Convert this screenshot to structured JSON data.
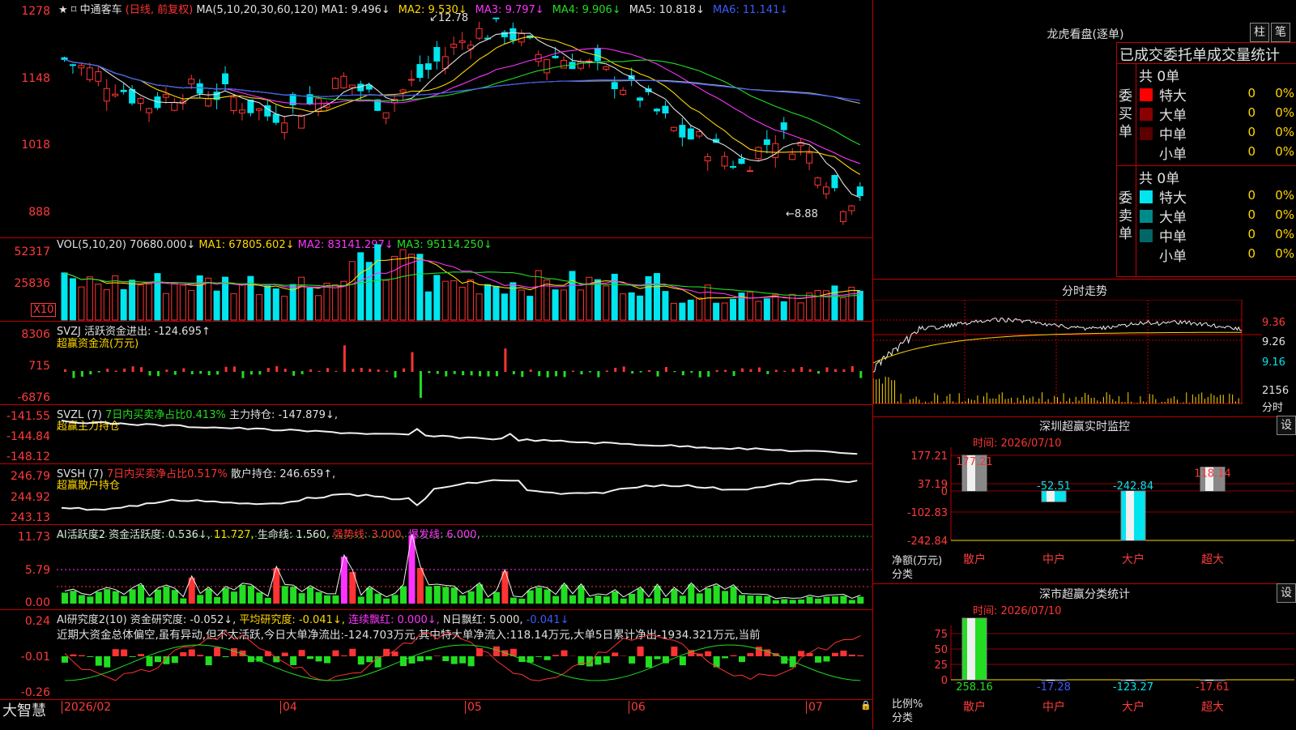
{
  "app": {
    "logo": "大智慧"
  },
  "stock": {
    "name": "中通客车",
    "mode": "(日线, 前复权)"
  },
  "main_panel": {
    "ma_header": "MA(5,10,20,30,60,120)",
    "ma": [
      {
        "label": "MA1: 9.496↓",
        "color": "#e0e0e0"
      },
      {
        "label": "MA2: 9.530↓",
        "color": "#ffd700"
      },
      {
        "label": "MA3: 9.797↓",
        "color": "#ff33ff"
      },
      {
        "label": "MA4: 9.906↓",
        "color": "#22dd22"
      },
      {
        "label": "MA5: 10.818↓",
        "color": "#e0e0e0"
      },
      {
        "label": "MA6: 11.141↓",
        "color": "#3b5bff"
      }
    ],
    "y_ticks": [
      "1278",
      "1148",
      "1018",
      "888"
    ],
    "high_label": "12.78",
    "low_label": "←8.88"
  },
  "vol_panel": {
    "header": "VOL(5,10,20)",
    "value": "70680.000↓",
    "ma1": "MA1: 67805.602↓",
    "ma2": "MA2: 83141.297↓",
    "ma3": "MA3: 95114.250↓",
    "y_ticks": [
      "52317",
      "25836"
    ],
    "unit": "X10"
  },
  "svzj_panel": {
    "name": "SVZJ",
    "label": "活跃资金进出: -124.695↑",
    "sub": "超赢资金流(万元)",
    "y_ticks": [
      "8306",
      "715",
      "-6876"
    ]
  },
  "svzl_panel": {
    "name": "SVZL (7)",
    "ratio": "7日内买卖净占比0.413%",
    "hold": "主力持仓: -147.879↓,",
    "sub": "超赢主力持仓",
    "y_ticks": [
      "-141.55",
      "-144.84",
      "-148.12"
    ]
  },
  "svsh_panel": {
    "name": "SVSH (7)",
    "ratio": "7日内买卖净占比0.517%",
    "hold": "散户持仓: 246.659↑,",
    "sub": "超赢散户持仓",
    "y_ticks": [
      "246.79",
      "244.92",
      "243.13"
    ]
  },
  "ai_active_panel": {
    "name": "AI活跃度2",
    "degree": "资金活跃度: 0.536↓,",
    "v2": "11.727,",
    "life": "生命线: 1.560,",
    "strong": "强势线: 3.000,",
    "burst": "爆发线: 6.000,",
    "y_ticks": [
      "11.73",
      "5.79",
      "0.00"
    ]
  },
  "ai_research_panel": {
    "name": "AI研究度2(10)",
    "research": "资金研究度: -0.052↓,",
    "avg": "平均研究度: -0.041↓,",
    "red": "连续飘红: 0.000↓,",
    "nred": "N日飘红: 5.000,",
    "last": "-0.041↓",
    "note": "近期大资金总体偏空,虽有异动,但不太活跃,今日大单净流出:-124.703万元,其中特大单净流入:118.14万元,大单5日累计净出-1934.321万元,当前",
    "y_ticks": [
      "0.24",
      "-0.01",
      "-0.26"
    ]
  },
  "x_axis": {
    "labels": [
      "2026/02",
      "04",
      "05",
      "06",
      "07"
    ]
  },
  "lhb": {
    "title": "龙虎看盘(逐单)",
    "btn1": "柱",
    "btn2": "笔",
    "header": "已成交委托单成交量统计",
    "buy": {
      "side": "委买单",
      "total": "共 0单",
      "rows": [
        {
          "name": "特大",
          "qty": "0",
          "pct": "0%",
          "color": "#ff0000"
        },
        {
          "name": "大单",
          "qty": "0",
          "pct": "0%",
          "color": "#8b0000"
        },
        {
          "name": "中单",
          "qty": "0",
          "pct": "0%",
          "color": "#5a0000"
        },
        {
          "name": "小单",
          "qty": "0",
          "pct": "0%",
          "color": "#000000"
        }
      ]
    },
    "sell": {
      "side": "委卖单",
      "total": "共 0单",
      "rows": [
        {
          "name": "特大",
          "qty": "0",
          "pct": "0%",
          "color": "#00e5ee"
        },
        {
          "name": "大单",
          "qty": "0",
          "pct": "0%",
          "color": "#008b8b"
        },
        {
          "name": "中单",
          "qty": "0",
          "pct": "0%",
          "color": "#006666"
        },
        {
          "name": "小单",
          "qty": "0",
          "pct": "0%",
          "color": "#000000"
        }
      ]
    }
  },
  "intraday": {
    "title": "分时走势",
    "price_ticks": [
      "9.36",
      "9.26",
      "9.16"
    ],
    "vol_tick": "2156",
    "vol_label": "分时"
  },
  "sz_monitor": {
    "title": "深圳超赢实时监控",
    "btn": "设",
    "time": "时间: 2026/07/10",
    "y_ticks": [
      "177.21",
      "37.19",
      "0",
      "-102.83",
      "-242.84"
    ],
    "ylabel": "净额(万元)",
    "xlabel": "分类",
    "categories": [
      "散户",
      "中户",
      "大户",
      "超大"
    ],
    "values": [
      177.21,
      -52.51,
      -242.84,
      118.14
    ],
    "value_labels": [
      "177.21",
      "-52.51",
      "-242.84",
      "118.14"
    ]
  },
  "sz_class": {
    "title": "深市超赢分类统计",
    "btn": "设",
    "time": "时间: 2026/07/10",
    "y_ticks": [
      "75",
      "50",
      "25",
      "0"
    ],
    "ylabel": "比例%",
    "xlabel": "分类",
    "categories": [
      "散户",
      "中户",
      "大户",
      "超大"
    ],
    "values": [
      258.16,
      -17.28,
      -123.27,
      -17.61
    ],
    "value_labels": [
      "258.16",
      "-17.28",
      "-123.27",
      "-17.61"
    ]
  },
  "colors": {
    "up": "#ff3333",
    "down": "#00e5ee",
    "grid": "#c00000"
  }
}
